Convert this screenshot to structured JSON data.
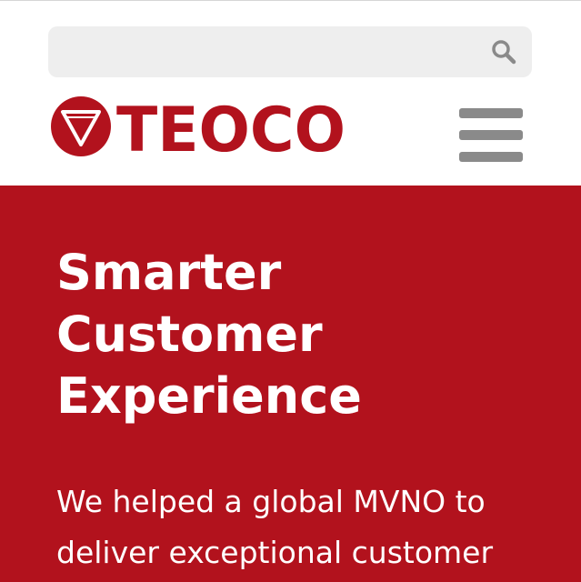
{
  "header": {
    "search": {
      "value": "",
      "placeholder": "",
      "icon": "search-icon"
    },
    "logo": {
      "text": "TEOCO",
      "color": "#b2121d"
    },
    "menu": {
      "icon": "hamburger-menu-icon",
      "color": "#8a8a8a"
    }
  },
  "hero": {
    "background_color": "#b2121d",
    "title_lines": [
      "Smarter",
      "Customer",
      "Experience"
    ],
    "body_lines": [
      "We helped a global MVNO to",
      "deliver exceptional customer"
    ]
  }
}
